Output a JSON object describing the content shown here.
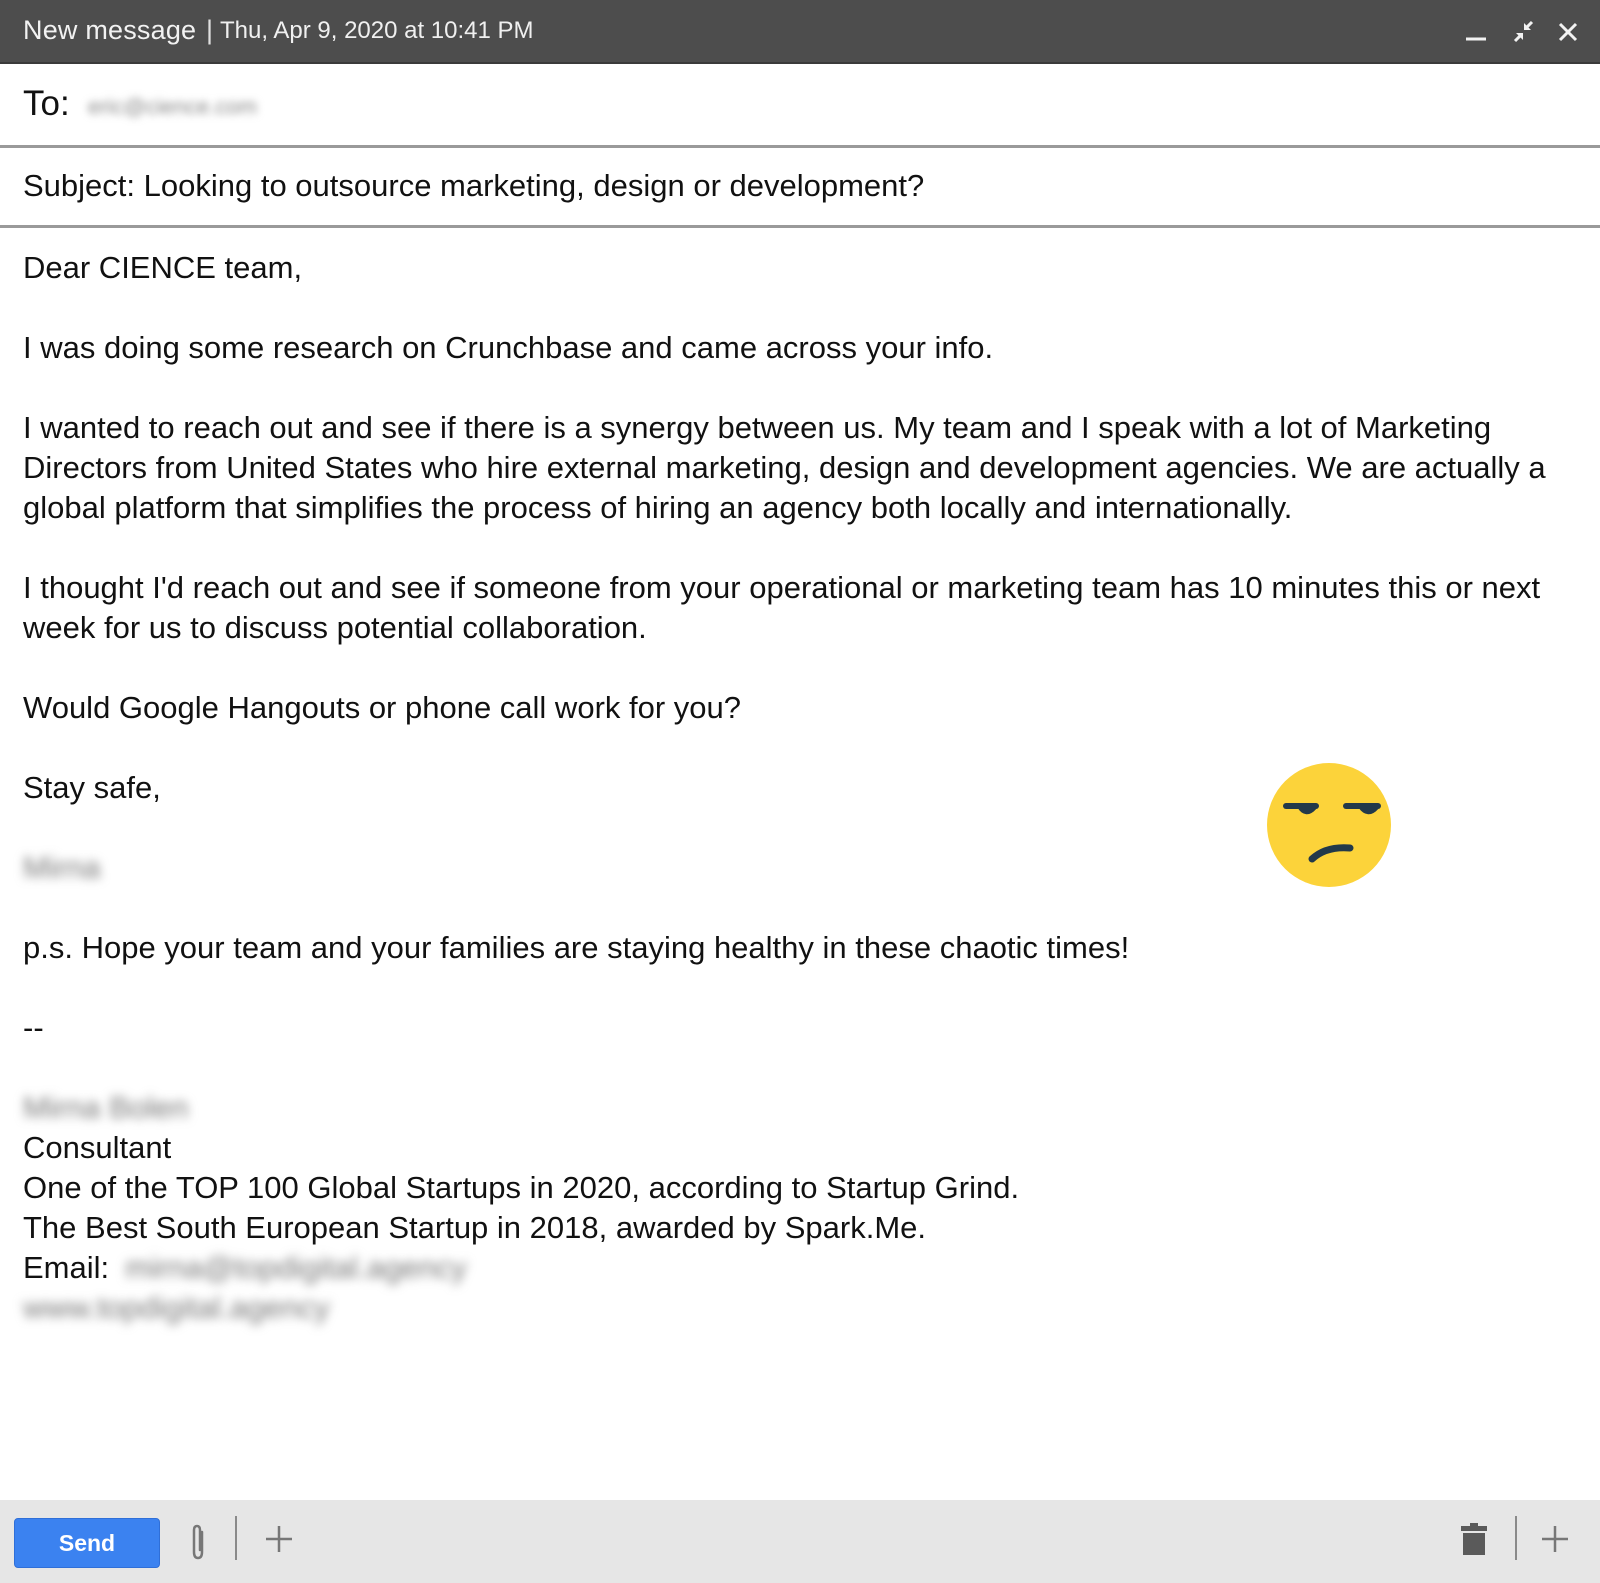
{
  "window": {
    "title": "New message",
    "separator": "|",
    "date": "Thu, Apr 9, 2020 at 10:41 PM",
    "controls": [
      "minimize-icon",
      "restore-icon",
      "close-icon"
    ]
  },
  "header": {
    "to_label": "To:",
    "to_value": "eric@cience.com",
    "subject_label": "Subject: Looking to outsource marketing, design or development?"
  },
  "body": {
    "greeting": "Dear CIENCE team,",
    "paragraphs": [
      "I was doing some research on Crunchbase and came across your info.",
      "I wanted to reach out and see if there is a synergy between us. My team and I speak with a lot of Marketing Directors from United States who hire external marketing, design and development agencies. We are actually a global platform that simplifies the process of hiring an agency both locally and internationally.",
      "I thought I'd reach out and see if someone from your operational or marketing team has 10 minutes this or next week for us to discuss potential collaboration.",
      "Would Google Hangouts or phone call work for you?"
    ],
    "closing": "Stay safe,",
    "sender_first_name": "Mirna",
    "ps": "p.s. Hope your team and your families are staying healthy in these chaotic times!",
    "sig_separator": "--",
    "signature": {
      "full_name": "Mirna Bolen",
      "title": "Consultant",
      "line1": "One of the TOP 100 Global Startups in 2020, according to Startup Grind.",
      "line2": "The Best South European Startup in 2018, awarded by Spark.Me.",
      "email_label": "Email:",
      "email_value": "mirna@topdigital.agency",
      "website": "www.topdigital.agency"
    }
  },
  "overlay": {
    "emoji": "unamused-face-emoji",
    "emoji_color": "#fcd33a"
  },
  "toolbar": {
    "send_label": "Send",
    "send_color": "#3b82f0",
    "left_icons": [
      "paperclip-icon",
      "plus-icon"
    ],
    "right_icons": [
      "trash-icon",
      "plus-icon"
    ]
  }
}
